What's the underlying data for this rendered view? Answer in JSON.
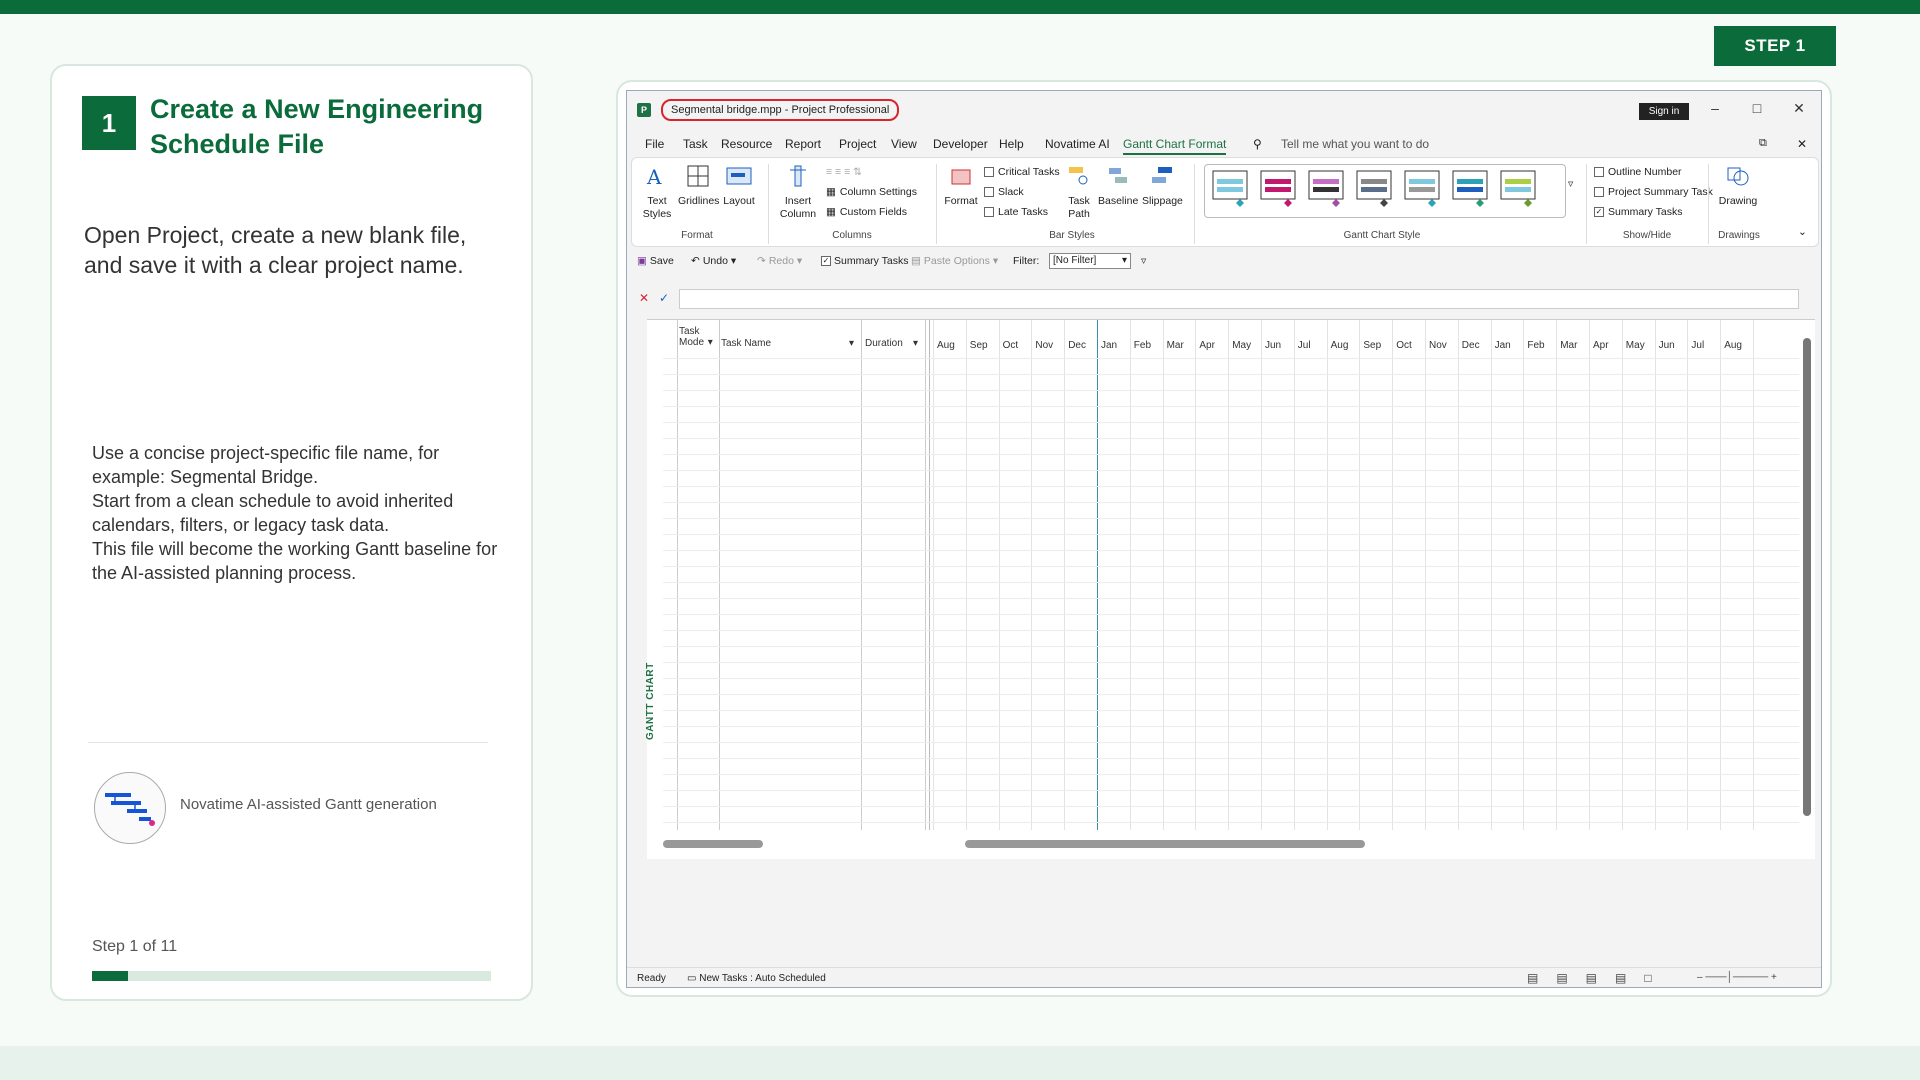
{
  "step_badge": "STEP 1",
  "card": {
    "number": "1",
    "title": "Create a New Engineering Schedule File",
    "description": "Open Project, create a new blank file, and save it with a clear project name.",
    "bullets": [
      "Use a concise project-specific file name, for example: Segmental Bridge.",
      "Start from a clean schedule to avoid inherited calendars, filters, or legacy task data.",
      "This file will become the working Gantt baseline for the AI-assisted planning process."
    ],
    "logo_caption": "Novatime AI-assisted Gantt generation",
    "step_counter": "Step 1 of 11",
    "progress_fraction": 0.0909
  },
  "window": {
    "title": "Segmental bridge.mpp  -  Project Professional",
    "sign_in": "Sign in",
    "menu": [
      "File",
      "Task",
      "Resource",
      "Report",
      "Project",
      "View",
      "Developer",
      "Help",
      "Novatime AI",
      "Gantt Chart Format"
    ],
    "active_menu": "Gantt Chart Format",
    "tell_me": "Tell me what you want to do",
    "ribbon": {
      "format_group": {
        "label": "Format",
        "text_styles": "Text Styles",
        "gridlines": "Gridlines",
        "layout": "Layout"
      },
      "columns_group": {
        "label": "Columns",
        "insert_column": "Insert Column",
        "column_settings": "Column Settings",
        "custom_fields": "Custom Fields"
      },
      "bar_styles_group": {
        "label": "Bar Styles",
        "format": "Format",
        "critical_tasks": "Critical Tasks",
        "slack": "Slack",
        "late_tasks": "Late Tasks",
        "task_path": "Task Path",
        "baseline": "Baseline",
        "slippage": "Slippage"
      },
      "gantt_style_group": {
        "label": "Gantt Chart Style"
      },
      "show_hide_group": {
        "label": "Show/Hide",
        "outline_number": "Outline Number",
        "project_summary_task": "Project Summary Task",
        "summary_tasks": "Summary Tasks"
      },
      "drawings_group": {
        "label": "Drawings",
        "drawing": "Drawing"
      }
    },
    "qat": {
      "save": "Save",
      "undo": "Undo",
      "redo": "Redo",
      "summary_tasks": "Summary Tasks",
      "paste_options": "Paste Options",
      "filter_label": "Filter:",
      "filter_value": "[No Filter]"
    },
    "table": {
      "task_mode": "Task Mode",
      "task_name": "Task Name",
      "duration": "Duration"
    },
    "side_label": "GANTT CHART",
    "months": [
      "Aug",
      "Sep",
      "Oct",
      "Nov",
      "Dec",
      "Jan",
      "Feb",
      "Mar",
      "Apr",
      "May",
      "Jun",
      "Jul",
      "Aug",
      "Sep",
      "Oct",
      "Nov",
      "Dec",
      "Jan",
      "Feb",
      "Mar",
      "Apr",
      "May",
      "Jun",
      "Jul",
      "Aug"
    ],
    "status": {
      "ready": "Ready",
      "new_tasks": "New Tasks : Auto Scheduled"
    }
  },
  "colors": {
    "brand_green": "#0b6b3a",
    "highlight_red": "#d9232d"
  }
}
